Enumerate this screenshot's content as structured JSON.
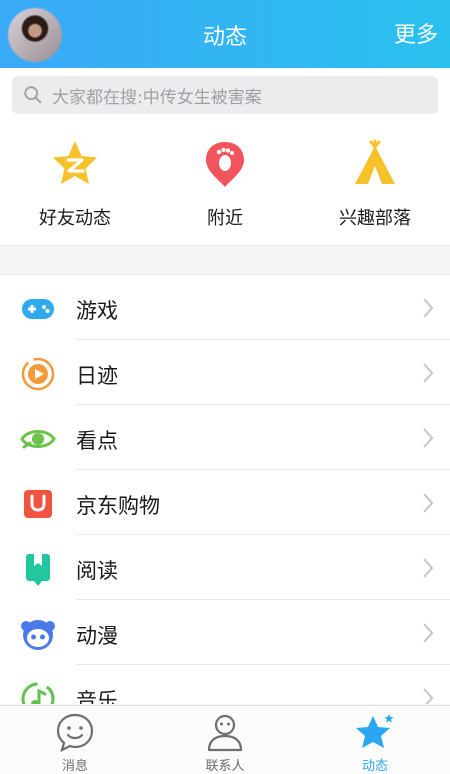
{
  "header": {
    "title": "动态",
    "more_label": "更多"
  },
  "search": {
    "placeholder": "大家都在搜:中传女生被害案"
  },
  "quick_entries": [
    {
      "label": "好友动态",
      "icon": "qzone-star-icon",
      "color": "#f7c12a"
    },
    {
      "label": "附近",
      "icon": "location-footprint-icon",
      "color": "#f2545b"
    },
    {
      "label": "兴趣部落",
      "icon": "tent-icon",
      "color": "#f7c12a"
    }
  ],
  "list": [
    {
      "label": "游戏",
      "icon": "gamepad-icon",
      "color": "#2eaaf0"
    },
    {
      "label": "日迹",
      "icon": "play-circle-icon",
      "color": "#f59a3a"
    },
    {
      "label": "看点",
      "icon": "eye-icon",
      "color": "#6cc24a"
    },
    {
      "label": "京东购物",
      "icon": "shopping-bag-icon",
      "color": "#f0533f"
    },
    {
      "label": "阅读",
      "icon": "bookmark-book-icon",
      "color": "#22c7a0"
    },
    {
      "label": "动漫",
      "icon": "anime-face-icon",
      "color": "#4a79e8"
    },
    {
      "label": "音乐",
      "icon": "music-note-icon",
      "color": "#5cc44c"
    }
  ],
  "tabs": [
    {
      "label": "消息",
      "icon": "message-smile-icon",
      "active": false
    },
    {
      "label": "联系人",
      "icon": "contact-person-icon",
      "active": false
    },
    {
      "label": "动态",
      "icon": "star-icon",
      "active": true
    }
  ]
}
